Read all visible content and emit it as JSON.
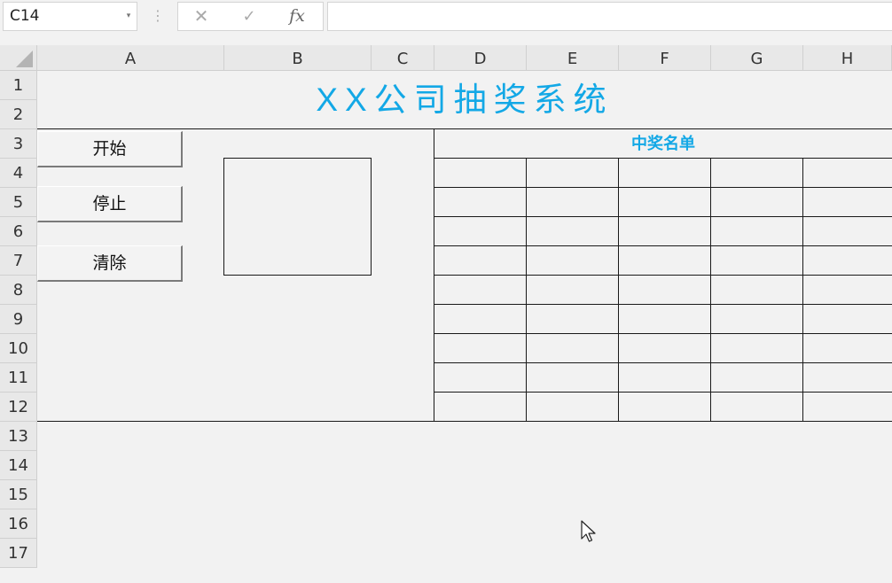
{
  "formula_bar": {
    "name_box": "C14",
    "name_box_arrow": "▾",
    "dots": "⋮",
    "cancel": "✕",
    "enter": "✓",
    "fx": "fx",
    "formula": ""
  },
  "columns": [
    "A",
    "B",
    "C",
    "D",
    "E",
    "F",
    "G",
    "H"
  ],
  "rows": [
    "1",
    "2",
    "3",
    "4",
    "5",
    "6",
    "7",
    "8",
    "9",
    "10",
    "11",
    "12",
    "13",
    "14",
    "15",
    "16",
    "17"
  ],
  "sheet": {
    "title": "XX公司抽奖系统",
    "winner_list_title": "中奖名单",
    "buttons": {
      "start": "开始",
      "stop": "停止",
      "clear": "清除"
    },
    "display_value": ""
  },
  "colors": {
    "accent": "#13a8e6",
    "border": "#1a1a1a",
    "background": "#f2f2f2"
  },
  "icons": {
    "cursor": "arrow-cursor-icon",
    "corner": "select-all-triangle-icon"
  }
}
